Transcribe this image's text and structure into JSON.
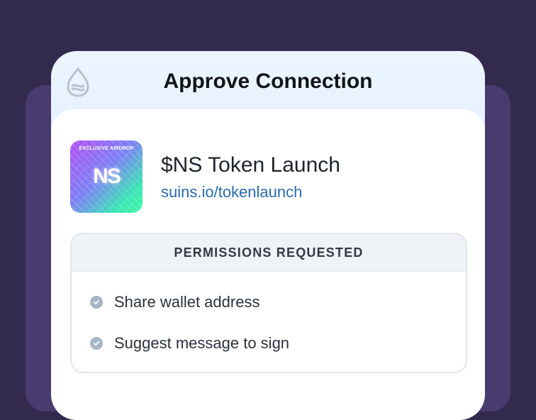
{
  "header": {
    "title": "Approve Connection",
    "logo_icon": "sui-droplet-icon"
  },
  "dapp": {
    "icon": {
      "tag": "EXCLUSIVE AIRDROP",
      "mark": "NS"
    },
    "name": "$NS Token Launch",
    "url": "suins.io/tokenlaunch"
  },
  "permissions": {
    "heading": "PERMISSIONS REQUESTED",
    "items": [
      {
        "label": "Share wallet address",
        "icon": "check-circle-icon"
      },
      {
        "label": "Suggest message to sign",
        "icon": "check-circle-icon"
      }
    ]
  },
  "colors": {
    "background": "#332b4e",
    "backdrop": "#483c6f",
    "link": "#2a6bb0",
    "check": "#a7b4c6"
  }
}
